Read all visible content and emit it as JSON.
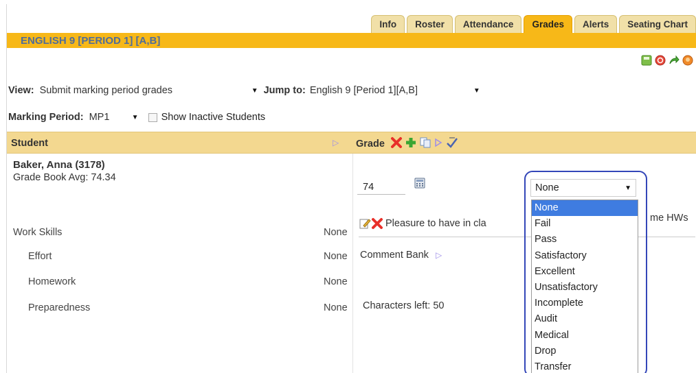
{
  "tabs": [
    {
      "label": "Info",
      "active": false
    },
    {
      "label": "Roster",
      "active": false
    },
    {
      "label": "Attendance",
      "active": false
    },
    {
      "label": "Grades",
      "active": true
    },
    {
      "label": "Alerts",
      "active": false
    },
    {
      "label": "Seating Chart",
      "active": false
    }
  ],
  "section_title": "ENGLISH 9 [PERIOD 1] [A,B]",
  "toolbar_icons": [
    "save-icon",
    "refresh-icon",
    "export-icon",
    "help-icon"
  ],
  "filters": {
    "view_label": "View:",
    "view_value": "Submit marking period grades",
    "jump_label": "Jump to:",
    "jump_value": "English 9 [Period 1][A,B]",
    "mp_label": "Marking Period:",
    "mp_value": "MP1",
    "show_inactive_label": "Show Inactive Students"
  },
  "grid": {
    "student_header": "Student",
    "grade_header": "Grade"
  },
  "student": {
    "name": "Baker, Anna (3178)",
    "avg": "Grade Book Avg: 74.34",
    "grade_value": "74",
    "skills": [
      {
        "label": "Work Skills",
        "value": "None"
      },
      {
        "label": "Effort",
        "value": "None"
      },
      {
        "label": "Homework",
        "value": "None"
      },
      {
        "label": "Preparedness",
        "value": "None"
      }
    ],
    "comment": "Pleasure to have in cla",
    "comment_suffix": "me HWs",
    "comment_bank_label": "Comment Bank",
    "chars_left": "Characters left: 50",
    "status_value": "None",
    "status_options": [
      "None",
      "Fail",
      "Pass",
      "Satisfactory",
      "Excellent",
      "Unsatisfactory",
      "Incomplete",
      "Audit",
      "Medical",
      "Drop",
      "Transfer"
    ]
  },
  "colors": {
    "accent": "#f7b818",
    "title_text": "#4f6d9a",
    "header_bg": "#f3d890",
    "selection": "#3f7ce0",
    "highlight_ring": "#3346b8"
  }
}
